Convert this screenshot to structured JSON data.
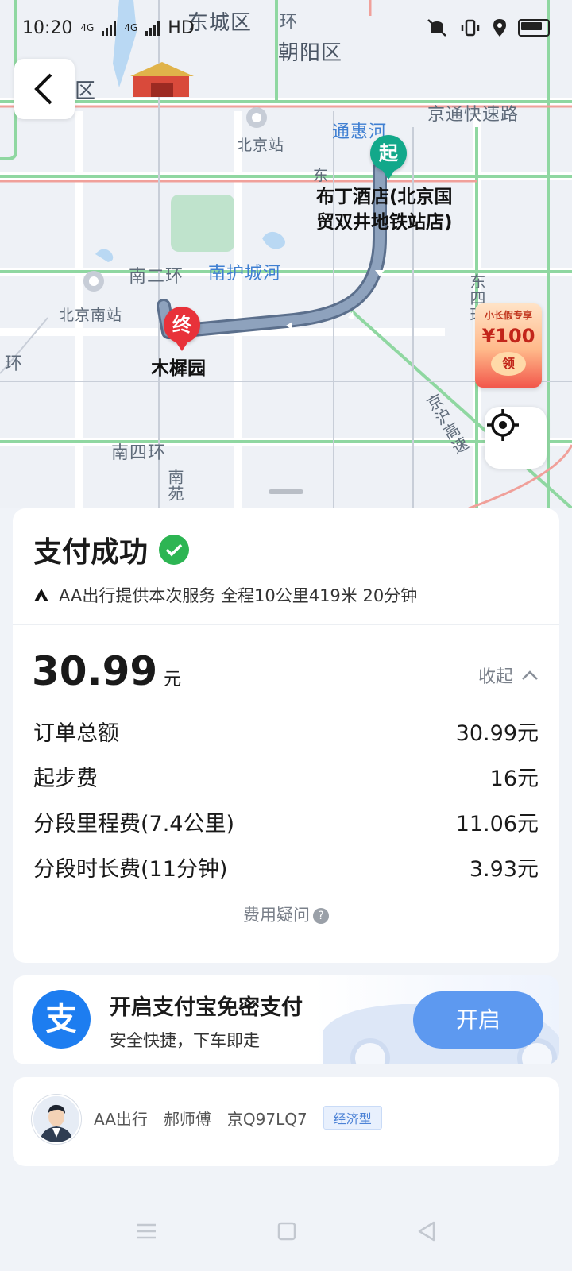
{
  "status_bar": {
    "time": "10:20",
    "network_1": "4G",
    "network_2": "4G",
    "hd": "HD",
    "icons": [
      "mute-icon",
      "vibrate-icon",
      "location-icon",
      "battery-icon"
    ]
  },
  "map": {
    "labels": {
      "dongcheng": "东城区",
      "chaoyang": "朝阳区",
      "huan_top": "环",
      "qu_left": "区",
      "jingtong": "京通快速路",
      "tonghui_river": "通惠河",
      "beijing_station": "北京站",
      "dong_small": "东",
      "nan_erhuan": "南二环",
      "nanhu_river": "南护城河",
      "beijing_south": "北京南站",
      "huan_left": "环",
      "dongsihuan": "东四环",
      "jinghu": "京沪高速",
      "nan_sihuan": "南四环",
      "nan_bottom": "南苑"
    },
    "start": {
      "badge": "起",
      "name_line1": "布丁酒店(北京国",
      "name_line2": "贸双井地铁站店)"
    },
    "end": {
      "badge": "终",
      "name": "木樨园"
    },
    "promo": {
      "top": "小长假专享",
      "amount": "¥100",
      "button": "领"
    }
  },
  "payment": {
    "title": "支付成功",
    "service": "AA出行提供本次服务 全程10公里419米 20分钟",
    "amount": "30.99",
    "amount_unit": "元",
    "collapse_label": "收起",
    "fees": [
      {
        "label": "订单总额",
        "value": "30.99元"
      },
      {
        "label": "起步费",
        "value": "16元"
      },
      {
        "label": "分段里程费(7.4公里)",
        "value": "11.06元"
      },
      {
        "label": "分段时长费(11分钟)",
        "value": "3.93元"
      }
    ],
    "fee_question": "费用疑问",
    "fee_question_mark": "?"
  },
  "alipay": {
    "logo": "支",
    "title": "开启支付宝免密支付",
    "subtitle": "安全快捷，下车即走",
    "button": "开启"
  },
  "driver": {
    "platform": "AA出行",
    "name": "郝师傅",
    "plate": "京Q97LQ7",
    "car_type": "经济型"
  },
  "colors": {
    "start_pin": "#12a88a",
    "end_pin": "#e8323a",
    "success_green": "#2db553",
    "alipay_blue": "#1d7df0",
    "open_button": "#5d99f0",
    "route": "#7d8fa8"
  }
}
